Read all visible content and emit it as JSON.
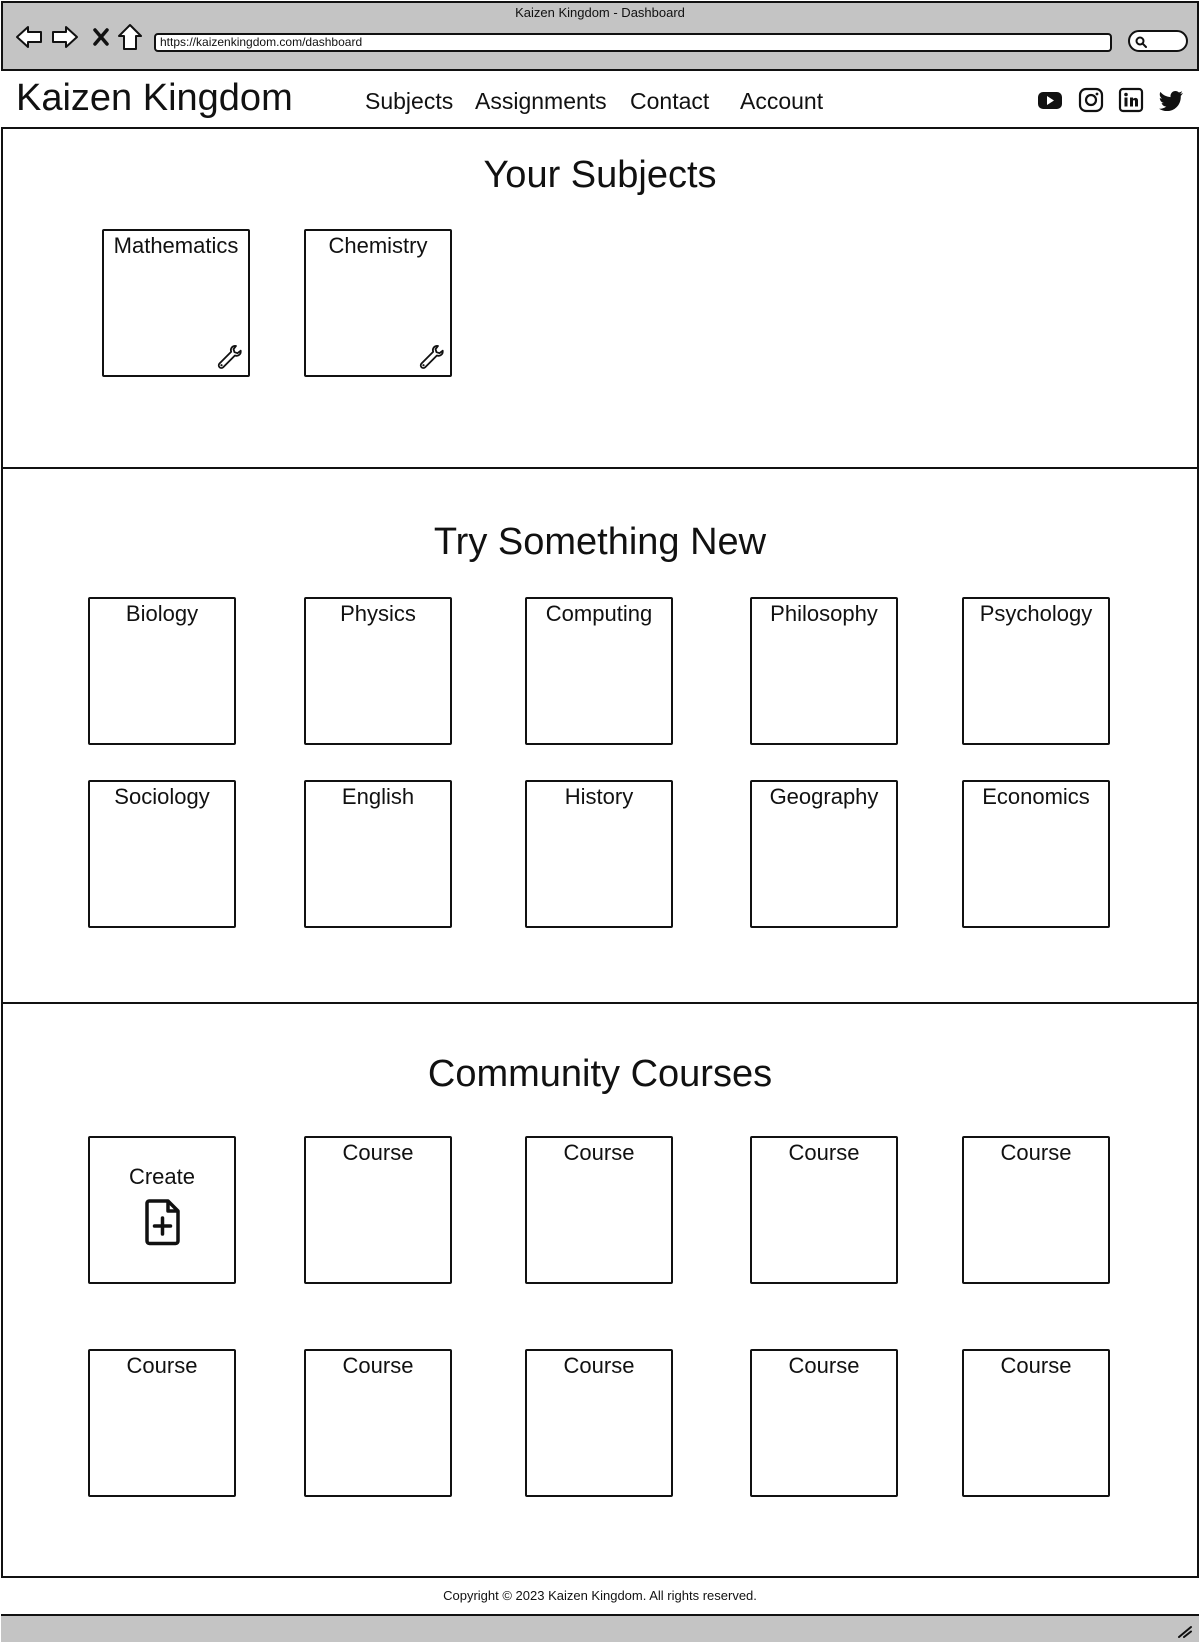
{
  "window": {
    "title": "Kaizen Kingdom - Dashboard",
    "url": "https://kaizenkingdom.com/dashboard",
    "nav_icons": [
      "back-arrow-icon",
      "forward-arrow-icon",
      "close-icon",
      "home-icon"
    ],
    "search_icon": "search-icon"
  },
  "header": {
    "logo": "Kaizen Kingdom",
    "nav": [
      "Subjects",
      "Assignments",
      "Contact",
      "Account"
    ],
    "social_icons": [
      "youtube-icon",
      "instagram-icon",
      "linkedin-icon",
      "twitter-icon"
    ]
  },
  "your_subjects": {
    "title": "Your Subjects",
    "cards": [
      "Mathematics",
      "Chemistry"
    ],
    "card_icon": "wrench-icon"
  },
  "try_new": {
    "title": "Try Something New",
    "cards": [
      "Biology",
      "Physics",
      "Computing",
      "Philosophy",
      "Psychology",
      "Sociology",
      "English",
      "History",
      "Geography",
      "Economics"
    ]
  },
  "community": {
    "title": "Community Courses",
    "create_label": "Create",
    "create_icon": "file-plus-icon",
    "cards": [
      "Course",
      "Course",
      "Course",
      "Course",
      "Course",
      "Course",
      "Course",
      "Course",
      "Course"
    ]
  },
  "footer": {
    "copyright": "Copyright © 2023 Kaizen Kingdom. All rights reserved."
  },
  "colors": {
    "chrome_gray": "#c4c4c4",
    "ink": "#111111",
    "background": "#ffffff"
  }
}
